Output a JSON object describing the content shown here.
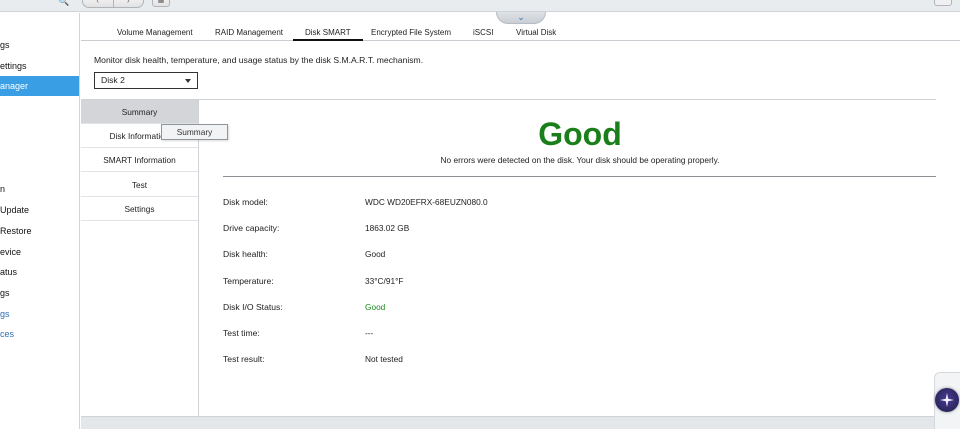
{
  "sidebar": {
    "items": [
      {
        "label": "gs",
        "state": "normal"
      },
      {
        "label": "ettings",
        "state": "normal"
      },
      {
        "label": "anager",
        "state": "active"
      },
      {
        "label": "n",
        "state": "normal"
      },
      {
        "label": "Update",
        "state": "normal"
      },
      {
        "label": "Restore",
        "state": "normal"
      },
      {
        "label": "evice",
        "state": "normal"
      },
      {
        "label": "atus",
        "state": "normal"
      },
      {
        "label": "gs",
        "state": "normal"
      },
      {
        "label": "gs",
        "state": "blue"
      },
      {
        "label": "ces",
        "state": "blue"
      }
    ]
  },
  "tabs": [
    {
      "label": "Volume Management"
    },
    {
      "label": "RAID Management"
    },
    {
      "label": "Disk SMART",
      "active": true
    },
    {
      "label": "Encrypted File System"
    },
    {
      "label": "iSCSI"
    },
    {
      "label": "Virtual Disk"
    }
  ],
  "description": "Monitor disk health, temperature, and usage status by the disk S.M.A.R.T. mechanism.",
  "disk_select": {
    "value": "Disk 2"
  },
  "submenu": [
    {
      "label": "Summary",
      "active": true
    },
    {
      "label": "Disk Information"
    },
    {
      "label": "SMART Information"
    },
    {
      "label": "Test"
    },
    {
      "label": "Settings"
    }
  ],
  "tooltip": "Summary",
  "status": {
    "title": "Good",
    "message": "No errors were detected on the disk. Your disk should be operating properly.",
    "color": "#1a7f1a"
  },
  "details": [
    {
      "label": "Disk model:",
      "value": "WDC WD20EFRX-68EUZN080.0"
    },
    {
      "label": "Drive capacity:",
      "value": "1863.02 GB"
    },
    {
      "label": "Disk health:",
      "value": "Good"
    },
    {
      "label": "Temperature:",
      "value": "33°C/91°F"
    },
    {
      "label": "Disk I/O Status:",
      "value": "Good",
      "good": true
    },
    {
      "label": "Test time:",
      "value": "---"
    },
    {
      "label": "Test result:",
      "value": "Not tested"
    }
  ],
  "icons": {
    "back": "chevron-left-icon",
    "forward": "chevron-right-icon",
    "apps": "grid-icon",
    "collapse": "chevron-down-icon",
    "assistant": "sparkle-icon",
    "dropdown": "caret-down-icon"
  }
}
